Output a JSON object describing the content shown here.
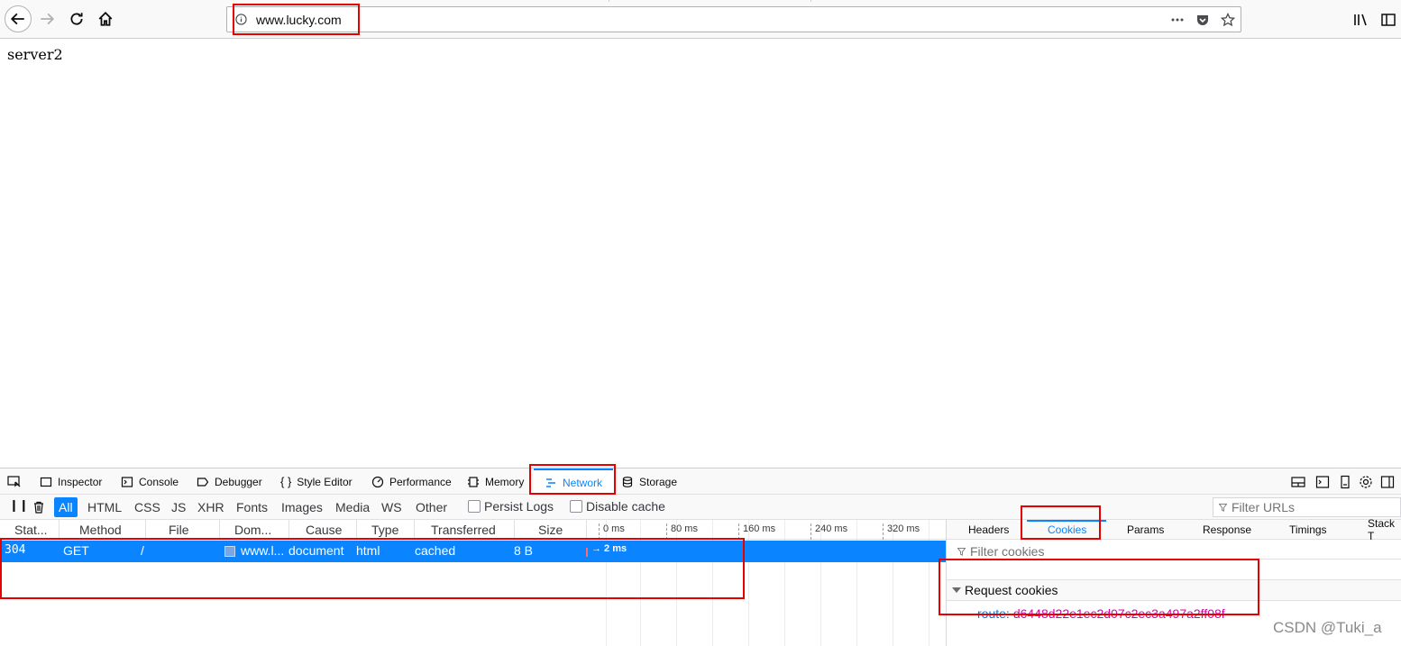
{
  "browser": {
    "url": "www.lucky.com"
  },
  "page": {
    "body_text": "server2"
  },
  "devtools": {
    "tabs": [
      "Inspector",
      "Console",
      "Debugger",
      "Style Editor",
      "Performance",
      "Memory",
      "Network",
      "Storage"
    ],
    "selected_tab": "Network",
    "filters": [
      "All",
      "HTML",
      "CSS",
      "JS",
      "XHR",
      "Fonts",
      "Images",
      "Media",
      "WS",
      "Other"
    ],
    "selected_filter": "All",
    "persist_logs_label": "Persist Logs",
    "disable_cache_label": "Disable cache",
    "filter_urls_placeholder": "Filter URLs",
    "columns": [
      "Stat...",
      "Method",
      "File",
      "Dom...",
      "Cause",
      "Type",
      "Transferred",
      "Size"
    ],
    "timeline_ticks": [
      "0 ms",
      "80 ms",
      "160 ms",
      "240 ms",
      "320 ms"
    ],
    "request": {
      "status": "304",
      "method": "GET",
      "file": "/",
      "domain": "www.l...",
      "cause": "document",
      "type": "html",
      "transferred": "cached",
      "size": "8 B",
      "timing": "→ 2 ms"
    },
    "side_tabs": [
      "Headers",
      "Cookies",
      "Params",
      "Response",
      "Timings",
      "Stack T"
    ],
    "selected_side_tab": "Cookies",
    "filter_cookies_placeholder": "Filter cookies",
    "request_cookies_heading": "Request cookies",
    "cookie": {
      "key": "route:",
      "value": "d6448d22e1ec2d07c2ec3a497a2ff08f"
    }
  },
  "watermark": "CSDN @Tuki_a",
  "colors": {
    "accent": "#0a84ff",
    "annotation": "#e60000",
    "cookie_key": "#0074e8",
    "cookie_value": "#dd00a9"
  }
}
